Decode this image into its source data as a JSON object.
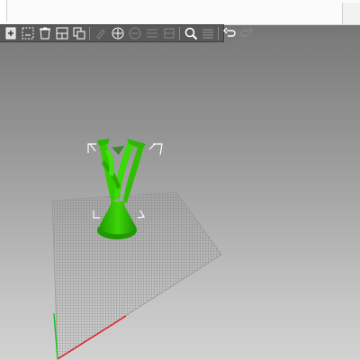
{
  "app": {
    "window_tabs": [
      {
        "name": "active-tab",
        "state": "active"
      },
      {
        "name": "inactive-tab",
        "state": "inactive"
      }
    ]
  },
  "toolbar": {
    "items": [
      {
        "id": "add-object",
        "icon": "add-object-icon",
        "enabled": true
      },
      {
        "id": "delete-selection",
        "icon": "delete-selection-icon",
        "enabled": true
      },
      {
        "id": "delete-all",
        "icon": "delete-all-icon",
        "enabled": true
      },
      {
        "id": "arrange",
        "icon": "arrange-icon",
        "enabled": true
      },
      {
        "id": "copy-paste",
        "icon": "copy-icon",
        "enabled": true
      },
      {
        "id": "paint",
        "icon": "paint-icon",
        "enabled": false
      },
      {
        "id": "add-instance",
        "icon": "add-instance-icon",
        "enabled": true
      },
      {
        "id": "remove-instance",
        "icon": "remove-instance-icon",
        "enabled": false
      },
      {
        "id": "split",
        "icon": "split-icon",
        "enabled": false
      },
      {
        "id": "layer-editing",
        "icon": "layer-editing-icon",
        "enabled": false
      },
      {
        "id": "search",
        "icon": "search-icon",
        "enabled": true
      },
      {
        "id": "layers-view",
        "icon": "layers-icon",
        "enabled": false
      },
      {
        "id": "undo",
        "icon": "undo-icon",
        "enabled": true
      },
      {
        "id": "redo",
        "icon": "redo-icon",
        "enabled": false
      }
    ]
  },
  "viewport": {
    "model_color": "#33cc00",
    "selection_box_color": "#ffffff",
    "bed_grid_color": "#7d7d7d",
    "axis_x_color": "#e02020",
    "axis_y_color": "#20c020"
  }
}
